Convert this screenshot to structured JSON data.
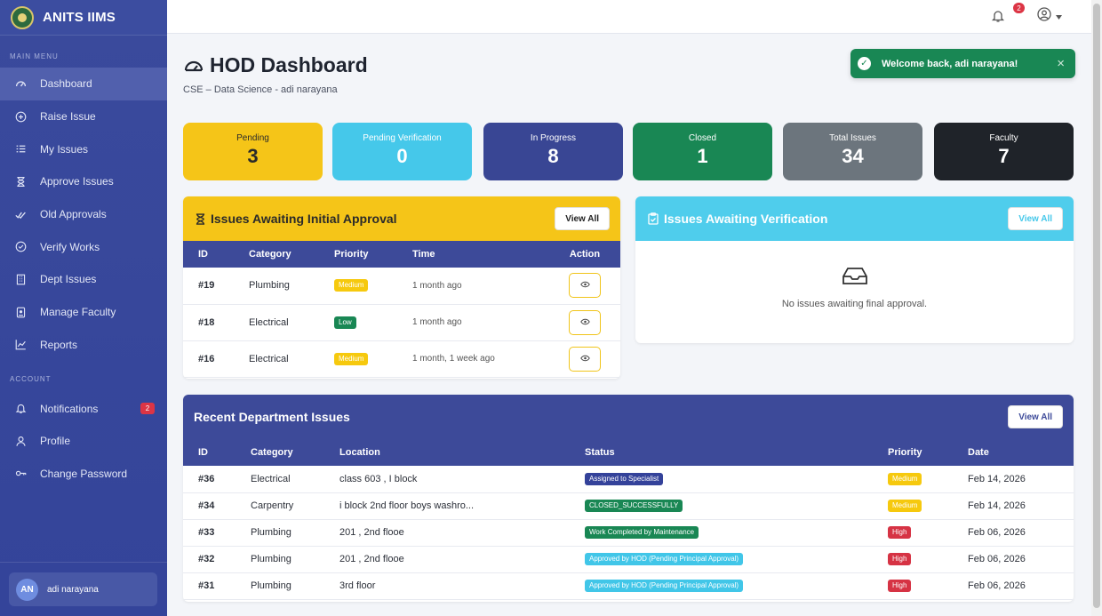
{
  "app": {
    "name": "ANITS IIMS"
  },
  "sidebar": {
    "main_menu_title": "MAIN MENU",
    "items": [
      {
        "label": "Dashboard",
        "icon": "gauge-icon"
      },
      {
        "label": "Raise Issue",
        "icon": "plus-circle-icon"
      },
      {
        "label": "My Issues",
        "icon": "list-icon"
      },
      {
        "label": "Approve Issues",
        "icon": "hourglass-icon"
      },
      {
        "label": "Old Approvals",
        "icon": "check-double-icon"
      },
      {
        "label": "Verify Works",
        "icon": "check-circle-icon"
      },
      {
        "label": "Dept Issues",
        "icon": "building-icon"
      },
      {
        "label": "Manage Faculty",
        "icon": "id-badge-icon"
      },
      {
        "label": "Reports",
        "icon": "chart-line-icon"
      }
    ],
    "account_title": "ACCOUNT",
    "account_items": [
      {
        "label": "Notifications",
        "icon": "bell-icon",
        "badge": "2"
      },
      {
        "label": "Profile",
        "icon": "user-icon"
      },
      {
        "label": "Change Password",
        "icon": "key-icon"
      }
    ],
    "user": {
      "initials": "AN",
      "name": "adi narayana"
    }
  },
  "topbar": {
    "notification_count": "2"
  },
  "page": {
    "title": "HOD Dashboard",
    "subtitle": "CSE – Data Science - adi narayana"
  },
  "toast": {
    "message": "Welcome back, adi narayana!",
    "close": "×"
  },
  "stats": [
    {
      "label": "Pending",
      "value": "3",
      "color": "#f5c518"
    },
    {
      "label": "Pending Verification",
      "value": "0",
      "color": "#45c8ea"
    },
    {
      "label": "In Progress",
      "value": "8",
      "color": "#394694"
    },
    {
      "label": "Closed",
      "value": "1",
      "color": "#198754"
    },
    {
      "label": "Total Issues",
      "value": "34",
      "color": "#6c757d"
    },
    {
      "label": "Faculty",
      "value": "7",
      "color": "#1f2329"
    }
  ],
  "initial_approval": {
    "title": "Issues Awaiting Initial Approval",
    "view_all": "View All",
    "columns": [
      "ID",
      "Category",
      "Priority",
      "Time",
      "Action"
    ],
    "rows": [
      {
        "id": "#19",
        "category": "Plumbing",
        "priority": "Medium",
        "time": "1 month ago"
      },
      {
        "id": "#18",
        "category": "Electrical",
        "priority": "Low",
        "time": "1 month ago"
      },
      {
        "id": "#16",
        "category": "Electrical",
        "priority": "Medium",
        "time": "1 month, 1 week ago"
      }
    ]
  },
  "verification": {
    "title": "Issues Awaiting Verification",
    "view_all": "View All",
    "empty_text": "No issues awaiting final approval."
  },
  "recent": {
    "title": "Recent Department Issues",
    "view_all": "View All",
    "columns": [
      "ID",
      "Category",
      "Location",
      "Status",
      "Priority",
      "Date"
    ],
    "rows": [
      {
        "id": "#36",
        "category": "Electrical",
        "location": "class 603 , I block",
        "status": "Assigned to Specialist",
        "status_color": "blue",
        "priority": "Medium",
        "date": "Feb 14, 2026"
      },
      {
        "id": "#34",
        "category": "Carpentry",
        "location": "i block 2nd floor boys washro...",
        "status": "CLOSED_SUCCESSFULLY",
        "status_color": "green",
        "priority": "Medium",
        "date": "Feb 14, 2026"
      },
      {
        "id": "#33",
        "category": "Plumbing",
        "location": "201 , 2nd flooe",
        "status": "Work Completed by Maintenance",
        "status_color": "green",
        "priority": "High",
        "date": "Feb 06, 2026"
      },
      {
        "id": "#32",
        "category": "Plumbing",
        "location": "201 , 2nd flooe",
        "status": "Approved by HOD (Pending Principal Approval)",
        "status_color": "cyan",
        "priority": "High",
        "date": "Feb 06, 2026"
      },
      {
        "id": "#31",
        "category": "Plumbing",
        "location": "3rd floor",
        "status": "Approved by HOD (Pending Principal Approval)",
        "status_color": "cyan",
        "priority": "High",
        "date": "Feb 06, 2026"
      }
    ]
  }
}
